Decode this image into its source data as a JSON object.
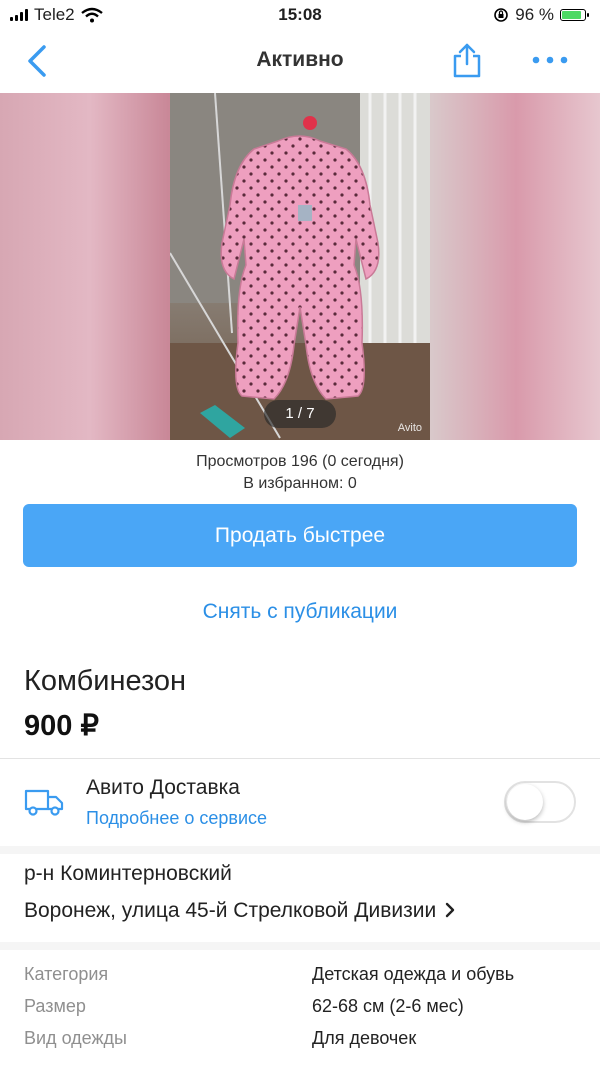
{
  "status_bar": {
    "carrier": "Tele2",
    "time": "15:08",
    "battery": "96 %",
    "battery_level": 0.96
  },
  "header": {
    "title": "Активно"
  },
  "gallery": {
    "counter": "1 / 7",
    "watermark": "Avito"
  },
  "stats": {
    "views": "Просмотров 196 (0 сегодня)",
    "favorites": "В избранном: 0"
  },
  "actions": {
    "sell_faster": "Продать быстрее",
    "unpublish": "Снять с публикации"
  },
  "item": {
    "title": "Комбинезон",
    "price": "900 ₽"
  },
  "delivery": {
    "title": "Авито Доставка",
    "link": "Подробнее о сервисе",
    "enabled": false
  },
  "location": {
    "district": "р-н Коминтерновский",
    "address": "Воронеж, улица 45-й Стрелковой Дивизии"
  },
  "params": [
    {
      "key": "Категория",
      "value": "Детская одежда и обувь"
    },
    {
      "key": "Размер",
      "value": "62-68 см (2-6 мес)"
    },
    {
      "key": "Вид одежды",
      "value": "Для девочек"
    }
  ],
  "colors": {
    "accent": "#4aa6f6",
    "link": "#2b8fe6",
    "product_pink": "#ee9fbf"
  }
}
